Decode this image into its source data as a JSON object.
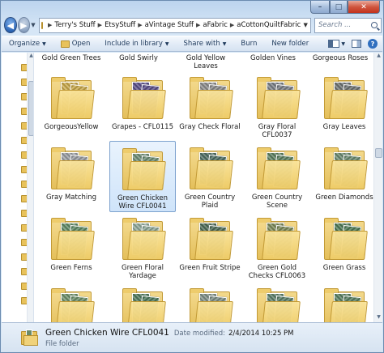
{
  "window": {
    "controls": {
      "minimize": "–",
      "maximize": "□",
      "close": "✕"
    }
  },
  "address": {
    "breadcrumbs": [
      "Terry's Stuff",
      "EtsyStuff",
      "aVintage Stuff",
      "aFabric",
      "aCottonQuiltFabric"
    ],
    "search_placeholder": "Search ..."
  },
  "commandbar": {
    "organize": "Organize",
    "open": "Open",
    "include": "Include in library",
    "share": "Share with",
    "burn": "Burn",
    "new_folder": "New folder"
  },
  "top_row_labels": [
    [
      "Gold Green Trees"
    ],
    [
      "Gold Swirly"
    ],
    [
      "Gold Yellow",
      "Leaves"
    ],
    [
      "Golden Vines"
    ],
    [
      "Gorgeous Roses"
    ]
  ],
  "folders": [
    {
      "label": [
        "GorgeousYellow"
      ],
      "paper": "#c9a94b",
      "selected": false
    },
    {
      "label": [
        "Grapes - CFL0115"
      ],
      "paper": "#5a4f8a",
      "selected": false
    },
    {
      "label": [
        "Gray Check Floral"
      ],
      "paper": "#8c8c8c",
      "selected": false
    },
    {
      "label": [
        "Gray Floral",
        "CFL0037"
      ],
      "paper": "#7a7f86",
      "selected": false
    },
    {
      "label": [
        "Gray Leaves"
      ],
      "paper": "#6e7372",
      "selected": false
    },
    {
      "label": [
        "Gray Matching"
      ],
      "paper": "#9a9da2",
      "selected": false
    },
    {
      "label": [
        "Green Chicken",
        "Wire CFL0041"
      ],
      "paper": "#6f8e76",
      "selected": true
    },
    {
      "label": [
        "Green Country",
        "Plaid"
      ],
      "paper": "#4f6e63",
      "selected": false
    },
    {
      "label": [
        "Green Country",
        "Scene"
      ],
      "paper": "#5d8060",
      "selected": false
    },
    {
      "label": [
        "Green Diamonds"
      ],
      "paper": "#6c8a70",
      "selected": false
    },
    {
      "label": [
        "Green Ferns"
      ],
      "paper": "#5f8a66",
      "selected": false
    },
    {
      "label": [
        "Green Floral",
        "Yardage"
      ],
      "paper": "#8fa89a",
      "selected": false
    },
    {
      "label": [
        "Green Fruit Stripe"
      ],
      "paper": "#4d6b57",
      "selected": false
    },
    {
      "label": [
        "Green Gold",
        "Checks CFL0063"
      ],
      "paper": "#7c8a5a",
      "selected": false
    },
    {
      "label": [
        "Green Grass"
      ],
      "paper": "#4f7a56",
      "selected": false
    },
    {
      "label": [
        ""
      ],
      "paper": "#6d8f6a",
      "selected": false
    },
    {
      "label": [
        ""
      ],
      "paper": "#4f7a5d",
      "selected": false
    },
    {
      "label": [
        ""
      ],
      "paper": "#7d8e86",
      "selected": false
    },
    {
      "label": [
        ""
      ],
      "paper": "#5c7f6a",
      "selected": false
    },
    {
      "label": [
        ""
      ],
      "paper": "#597f62",
      "selected": false
    }
  ],
  "details": {
    "name": "Green Chicken Wire CFL0041",
    "date_key": "Date modified:",
    "date_value": "2/4/2014 10:25 PM",
    "type": "File folder"
  }
}
